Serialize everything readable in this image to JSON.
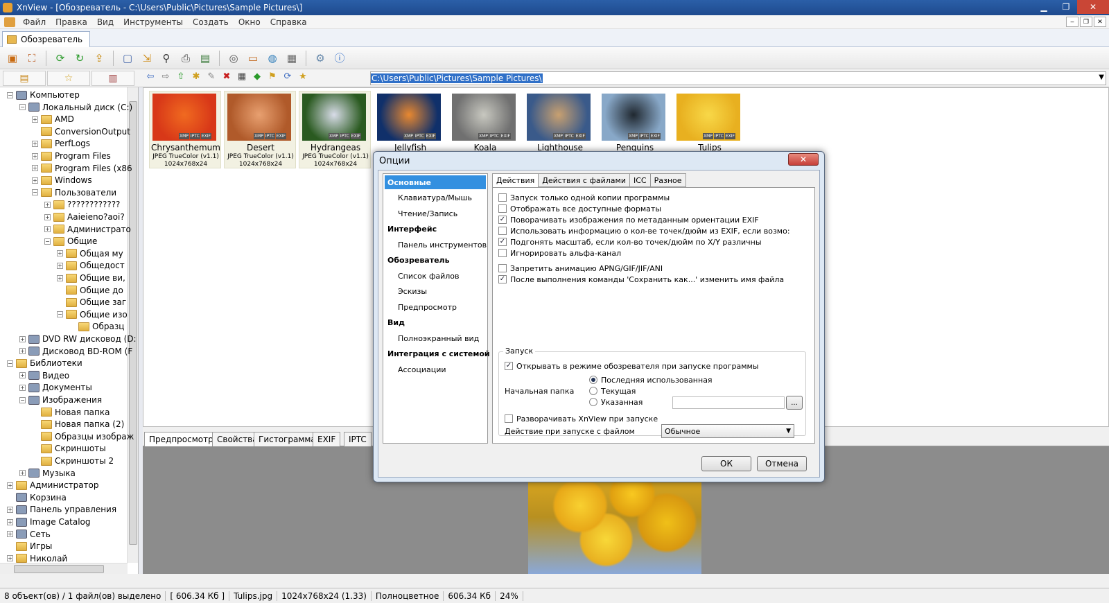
{
  "window": {
    "title": "XnView - [Обозреватель - C:\\Users\\Public\\Pictures\\Sample Pictures\\]",
    "min": "▁",
    "max": "❐",
    "close": "✕"
  },
  "menu": [
    "Файл",
    "Правка",
    "Вид",
    "Инструменты",
    "Создать",
    "Окно",
    "Справка"
  ],
  "doc_tab": "Обозреватель",
  "path": "C:\\Users\\Public\\Pictures\\Sample Pictures\\",
  "tree": [
    {
      "label": "Компьютер",
      "level": 0,
      "exp": "−",
      "icon": "drive-icon"
    },
    {
      "label": "Локальный диск (C:)",
      "level": 1,
      "exp": "−",
      "icon": "drive-icon"
    },
    {
      "label": "AMD",
      "level": 2,
      "exp": "+",
      "icon": "folder-icon"
    },
    {
      "label": "ConversionOutput",
      "level": 2,
      "exp": "",
      "icon": "folder-icon"
    },
    {
      "label": "PerfLogs",
      "level": 2,
      "exp": "+",
      "icon": "folder-icon"
    },
    {
      "label": "Program Files",
      "level": 2,
      "exp": "+",
      "icon": "folder-icon"
    },
    {
      "label": "Program Files (x86",
      "level": 2,
      "exp": "+",
      "icon": "folder-icon"
    },
    {
      "label": "Windows",
      "level": 2,
      "exp": "+",
      "icon": "folder-icon"
    },
    {
      "label": "Пользователи",
      "level": 2,
      "exp": "−",
      "icon": "folder-icon"
    },
    {
      "label": "????????????",
      "level": 3,
      "exp": "+",
      "icon": "folder-icon"
    },
    {
      "label": "Aaieieno?aoi?",
      "level": 3,
      "exp": "+",
      "icon": "folder-icon"
    },
    {
      "label": "Администрато",
      "level": 3,
      "exp": "+",
      "icon": "folder-icon"
    },
    {
      "label": "Общие",
      "level": 3,
      "exp": "−",
      "icon": "folder-icon"
    },
    {
      "label": "Общая му",
      "level": 4,
      "exp": "+",
      "icon": "folder-icon"
    },
    {
      "label": "Общедост",
      "level": 4,
      "exp": "+",
      "icon": "folder-icon"
    },
    {
      "label": "Общие ви,",
      "level": 4,
      "exp": "+",
      "icon": "folder-icon"
    },
    {
      "label": "Общие до",
      "level": 4,
      "exp": "",
      "icon": "folder-icon"
    },
    {
      "label": "Общие заг",
      "level": 4,
      "exp": "",
      "icon": "folder-icon"
    },
    {
      "label": "Общие изо",
      "level": 4,
      "exp": "−",
      "icon": "folder-icon"
    },
    {
      "label": "Образц",
      "level": 5,
      "exp": "",
      "icon": "folder-icon"
    },
    {
      "label": "DVD RW дисковод (D:",
      "level": 1,
      "exp": "+",
      "icon": "drive-icon"
    },
    {
      "label": "Дисковод BD-ROM (F",
      "level": 1,
      "exp": "+",
      "icon": "drive-icon"
    },
    {
      "label": "Библиотеки",
      "level": 0,
      "exp": "−",
      "icon": "folder-icon"
    },
    {
      "label": "Видео",
      "level": 1,
      "exp": "+",
      "icon": "drive-icon"
    },
    {
      "label": "Документы",
      "level": 1,
      "exp": "+",
      "icon": "drive-icon"
    },
    {
      "label": "Изображения",
      "level": 1,
      "exp": "−",
      "icon": "drive-icon"
    },
    {
      "label": "Новая папка",
      "level": 2,
      "exp": "",
      "icon": "folder-icon"
    },
    {
      "label": "Новая папка (2)",
      "level": 2,
      "exp": "",
      "icon": "folder-icon"
    },
    {
      "label": "Образцы изображ",
      "level": 2,
      "exp": "",
      "icon": "folder-icon"
    },
    {
      "label": "Скриншоты",
      "level": 2,
      "exp": "",
      "icon": "folder-icon"
    },
    {
      "label": "Скриншоты 2",
      "level": 2,
      "exp": "",
      "icon": "folder-icon"
    },
    {
      "label": "Музыка",
      "level": 1,
      "exp": "+",
      "icon": "drive-icon"
    },
    {
      "label": "Администратор",
      "level": 0,
      "exp": "+",
      "icon": "folder-icon"
    },
    {
      "label": "Корзина",
      "level": 0,
      "exp": "",
      "icon": "drive-icon"
    },
    {
      "label": "Панель управления",
      "level": 0,
      "exp": "+",
      "icon": "drive-icon"
    },
    {
      "label": "Image Catalog",
      "level": 0,
      "exp": "+",
      "icon": "drive-icon"
    },
    {
      "label": "Сеть",
      "level": 0,
      "exp": "+",
      "icon": "drive-icon"
    },
    {
      "label": "Игры",
      "level": 0,
      "exp": "",
      "icon": "folder-icon"
    },
    {
      "label": "Николай",
      "level": 0,
      "exp": "+",
      "icon": "folder-icon"
    }
  ],
  "thumbs": [
    {
      "name": "Chrysanthemum",
      "type": "JPEG TrueColor (v1.1)",
      "size": "1024x768x24",
      "color": "#d83818",
      "color2": "#f06a20"
    },
    {
      "name": "Desert",
      "type": "JPEG TrueColor (v1.1)",
      "size": "1024x768x24",
      "color": "#b05a2a",
      "color2": "#e8a070"
    },
    {
      "name": "Hydrangeas",
      "type": "JPEG TrueColor (v1.1)",
      "size": "1024x768x24",
      "color": "#2a5a20",
      "color2": "#d8dce8"
    },
    {
      "name": "Jellyfish",
      "type": "",
      "size": "",
      "color": "#10306a",
      "color2": "#e88830"
    },
    {
      "name": "Koala",
      "type": "",
      "size": "",
      "color": "#707070",
      "color2": "#c8c8c0"
    },
    {
      "name": "Lighthouse",
      "type": "",
      "size": "",
      "color": "#3a5a8a",
      "color2": "#c8a070"
    },
    {
      "name": "Penguins",
      "type": "",
      "size": "",
      "color": "#88a8c8",
      "color2": "#202830"
    },
    {
      "name": "Tulips",
      "type": "",
      "size": "",
      "color": "#e8b020",
      "color2": "#f8d848"
    }
  ],
  "badges": [
    "XMP",
    "IPTC",
    "EXIF"
  ],
  "preview_tabs": [
    "Предпросмотр",
    "Свойства",
    "Гистограмма",
    "EXIF",
    "IPTC"
  ],
  "status": [
    "8 объект(ов) / 1 файл(ов) выделено",
    "[ 606.34 Кб ]",
    "Tulips.jpg",
    "1024x768x24 (1.33)",
    "Полноцветное",
    "606.34 Кб",
    "24%"
  ],
  "dialog": {
    "title": "Опции",
    "close": "✕",
    "categories": [
      {
        "label": "Основные",
        "kind": "sel"
      },
      {
        "label": "Клавиатура/Мышь",
        "kind": "sub"
      },
      {
        "label": "Чтение/Запись",
        "kind": "sub"
      },
      {
        "label": "Интерфейс",
        "kind": "bold"
      },
      {
        "label": "Панель инструментов",
        "kind": "sub"
      },
      {
        "label": "Обозреватель",
        "kind": "bold"
      },
      {
        "label": "Список файлов",
        "kind": "sub"
      },
      {
        "label": "Эскизы",
        "kind": "sub"
      },
      {
        "label": "Предпросмотр",
        "kind": "sub"
      },
      {
        "label": "Вид",
        "kind": "bold"
      },
      {
        "label": "Полноэкранный вид",
        "kind": "sub"
      },
      {
        "label": "Интеграция с системой",
        "kind": "bold"
      },
      {
        "label": "Ассоциации",
        "kind": "sub"
      }
    ],
    "tabs": [
      "Действия",
      "Действия с файлами",
      "ICC",
      "Разное"
    ],
    "checks": [
      {
        "label": "Запуск только одной копии программы",
        "checked": false
      },
      {
        "label": "Отображать все доступные форматы",
        "checked": false
      },
      {
        "label": "Поворачивать изображения по метаданным ориентации EXIF",
        "checked": true
      },
      {
        "label": "Использовать информацию о кол-ве точек/дюйм из EXIF, если возмо:",
        "checked": false
      },
      {
        "label": "Подгонять масштаб, если кол-во точек/дюйм по X/Y различны",
        "checked": true
      },
      {
        "label": "Игнорировать альфа-канал",
        "checked": false
      },
      {
        "label": "Запретить анимацию APNG/GIF/JIF/ANI",
        "checked": false
      },
      {
        "label": "После выполнения команды 'Сохранить как...' изменить имя файла",
        "checked": true
      }
    ],
    "group": {
      "label": "Запуск",
      "open_browser": "Открывать в режиме обозревателя при запуске программы",
      "start_folder_label": "Начальная папка",
      "radios": [
        {
          "label": "Последняя использованная",
          "on": true
        },
        {
          "label": "Текущая",
          "on": false
        },
        {
          "label": "Указанная",
          "on": false
        }
      ],
      "browse": "...",
      "maximize": "Разворачивать XnView при запуске",
      "action_label": "Действие при запуске с файлом",
      "action_value": "Обычное"
    },
    "ok": "ОК",
    "cancel": "Отмена"
  }
}
